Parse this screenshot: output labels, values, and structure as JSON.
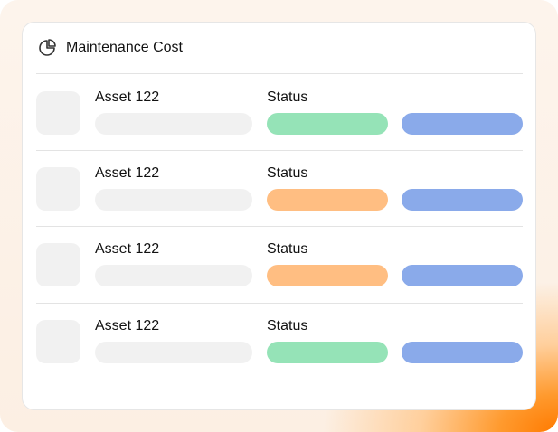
{
  "colors": {
    "status_green": "#95e3b7",
    "status_orange": "#ffbe82",
    "action_blue": "#8aaaea",
    "placeholder_gray": "#f1f1f1"
  },
  "card": {
    "title": "Maintenance Cost",
    "title_icon": "pie-chart-icon"
  },
  "rows": [
    {
      "asset_name": "Asset 122",
      "status_label": "Status",
      "status_color": "#95e3b7"
    },
    {
      "asset_name": "Asset 122",
      "status_label": "Status",
      "status_color": "#ffbe82"
    },
    {
      "asset_name": "Asset 122",
      "status_label": "Status",
      "status_color": "#ffbe82"
    },
    {
      "asset_name": "Asset 122",
      "status_label": "Status",
      "status_color": "#95e3b7"
    }
  ]
}
